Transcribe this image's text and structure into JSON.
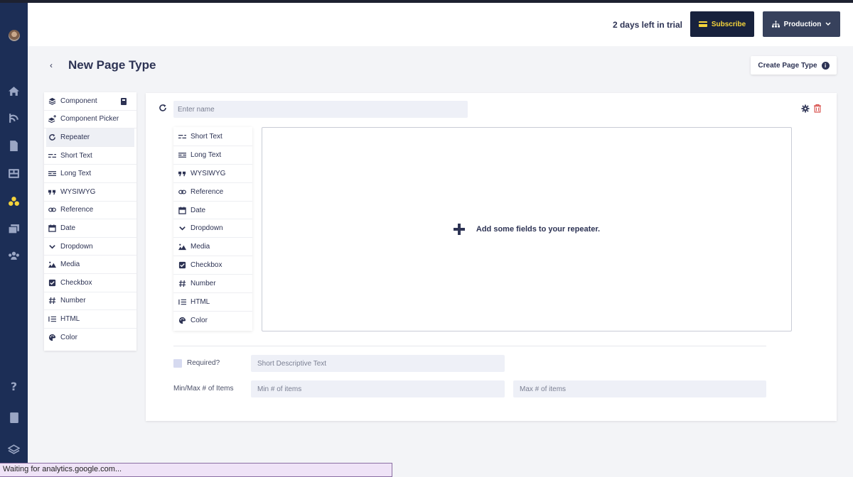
{
  "header": {
    "trial_text": "2 days left in trial",
    "subscribe_label": "Subscribe",
    "environment_label": "Production"
  },
  "page": {
    "back_label": "‹",
    "title": "New Page Type",
    "create_label": "Create Page Type",
    "info_label": "i"
  },
  "components_panel": {
    "items": [
      {
        "label": "Component",
        "icon": "layers-icon"
      },
      {
        "label": "Component Picker",
        "icon": "layers-plus-icon"
      },
      {
        "label": "Repeater",
        "icon": "repeat-icon"
      },
      {
        "label": "Short Text",
        "icon": "short-text-icon"
      },
      {
        "label": "Long Text",
        "icon": "long-text-icon"
      },
      {
        "label": "WYSIWYG",
        "icon": "quote-icon"
      },
      {
        "label": "Reference",
        "icon": "link-icon"
      },
      {
        "label": "Date",
        "icon": "calendar-icon"
      },
      {
        "label": "Dropdown",
        "icon": "chevron-down-icon"
      },
      {
        "label": "Media",
        "icon": "image-icon"
      },
      {
        "label": "Checkbox",
        "icon": "checkbox-icon"
      },
      {
        "label": "Number",
        "icon": "hash-icon"
      },
      {
        "label": "HTML",
        "icon": "list-icon"
      },
      {
        "label": "Color",
        "icon": "palette-icon"
      }
    ]
  },
  "repeater": {
    "name_placeholder": "Enter name",
    "fields": [
      {
        "label": "Short Text"
      },
      {
        "label": "Long Text"
      },
      {
        "label": "WYSIWYG"
      },
      {
        "label": "Reference"
      },
      {
        "label": "Date"
      },
      {
        "label": "Dropdown"
      },
      {
        "label": "Media"
      },
      {
        "label": "Checkbox"
      },
      {
        "label": "Number"
      },
      {
        "label": "HTML"
      },
      {
        "label": "Color"
      }
    ],
    "drop_text": "Add some fields to your repeater.",
    "required_label": "Required?",
    "description_placeholder": "Short Descriptive Text",
    "minmax_label": "Min/Max # of Items",
    "min_placeholder": "Min # of items",
    "max_placeholder": "Max # of items"
  },
  "status_bar": {
    "text": "Waiting for analytics.google.com..."
  },
  "colors": {
    "sidebar": "#1c2e56",
    "subscribe_bg": "#18223d",
    "subscribe_text": "#f5d43b",
    "text_primary": "#2d3354",
    "danger": "#d9534f"
  }
}
